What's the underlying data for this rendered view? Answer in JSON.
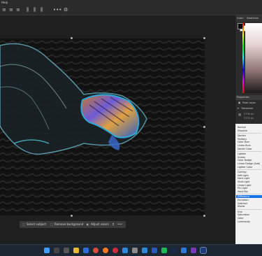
{
  "menubar": {
    "label": "Help"
  },
  "contextbar": {
    "select_subject": "Select subject",
    "remove_background": "Remove background",
    "adjust_colors": "Adjust colors",
    "more": "•••"
  },
  "panel": {
    "tabs": [
      "Color",
      "Swatches"
    ],
    "properties_tab": "Properties",
    "pixel_layer": "Pixel Layer",
    "transform": "Transform",
    "w_value": "3796 px",
    "h_value": "3133 px"
  },
  "blend_modes": {
    "groups": [
      [
        "Normal",
        "Dissolve"
      ],
      [
        "Darken",
        "Multiply",
        "Color Burn",
        "Linear Burn",
        "Darker Color"
      ],
      [
        "Lighten",
        "Screen",
        "Color Dodge",
        "Linear Dodge (Add)",
        "Lighter Color"
      ],
      [
        "Overlay",
        "Soft Light",
        "Hard Light",
        "Vivid Light",
        "Linear Light",
        "Pin Light",
        "Hard Mix"
      ],
      [
        "Difference",
        "Exclusion",
        "Subtract",
        "Divide"
      ],
      [
        "Hue",
        "Saturation",
        "Color",
        "Luminosity"
      ]
    ],
    "selected": "Difference"
  },
  "colors": {
    "workspace": "#1f1f1f",
    "panel": "#2b2b2b",
    "accent": "#1473e6",
    "taskbar": "#1c2733"
  },
  "taskbar_icons": [
    "windows-icon",
    "search-icon",
    "taskview-icon",
    "explorer-icon",
    "store-icon",
    "chrome-icon",
    "firefox-icon",
    "opera-icon",
    "mail-icon",
    "settings-icon",
    "photos-icon",
    "word-icon",
    "spotify-icon",
    "steam-icon",
    "vscode-icon",
    "onenote-icon",
    "photoshop-icon"
  ]
}
